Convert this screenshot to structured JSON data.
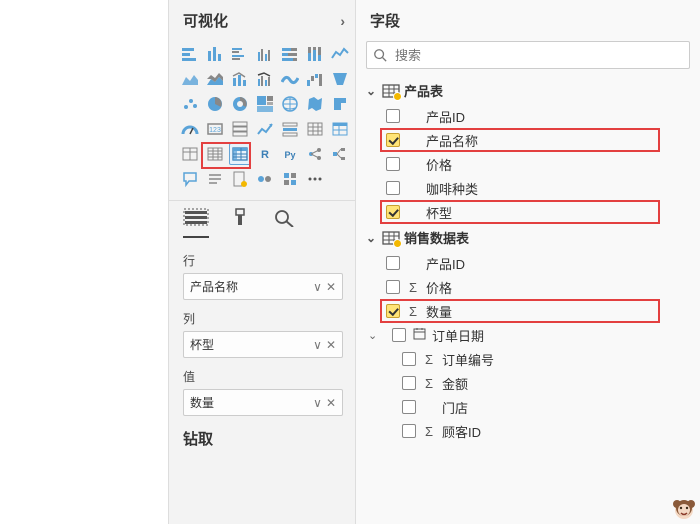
{
  "viz_panel": {
    "title": "可视化",
    "tabs": {
      "fields": "fields",
      "format": "format",
      "analytics": "analytics"
    },
    "rows_section": {
      "label": "行",
      "value": "产品名称"
    },
    "cols_section": {
      "label": "列",
      "value": "杯型"
    },
    "values_section": {
      "label": "值",
      "value": "数量"
    },
    "drill_label": "钻取"
  },
  "fields_panel": {
    "title": "字段",
    "search_placeholder": "搜索",
    "tables": [
      {
        "name": "产品表",
        "expanded": true,
        "fields": [
          {
            "label": "产品ID",
            "checked": false,
            "glyph": "",
            "hl": false
          },
          {
            "label": "产品名称",
            "checked": true,
            "glyph": "",
            "hl": true
          },
          {
            "label": "价格",
            "checked": false,
            "glyph": "",
            "hl": false
          },
          {
            "label": "咖啡种类",
            "checked": false,
            "glyph": "",
            "hl": false
          },
          {
            "label": "杯型",
            "checked": true,
            "glyph": "",
            "hl": true
          }
        ]
      },
      {
        "name": "销售数据表",
        "expanded": true,
        "fields": [
          {
            "label": "产品ID",
            "checked": false,
            "glyph": "",
            "hl": false
          },
          {
            "label": "价格",
            "checked": false,
            "glyph": "Σ",
            "hl": false
          },
          {
            "label": "数量",
            "checked": true,
            "glyph": "Σ",
            "hl": true
          },
          {
            "label": "订单日期",
            "checked": false,
            "glyph": "cal",
            "hl": false,
            "sub": true
          },
          {
            "label": "订单编号",
            "checked": false,
            "glyph": "Σ",
            "hl": false,
            "indent": true
          },
          {
            "label": "金额",
            "checked": false,
            "glyph": "Σ",
            "hl": false,
            "indent": true
          },
          {
            "label": "门店",
            "checked": false,
            "glyph": "",
            "hl": false,
            "indent": true
          },
          {
            "label": "顾客ID",
            "checked": false,
            "glyph": "Σ",
            "hl": false,
            "indent": true
          }
        ]
      }
    ]
  }
}
